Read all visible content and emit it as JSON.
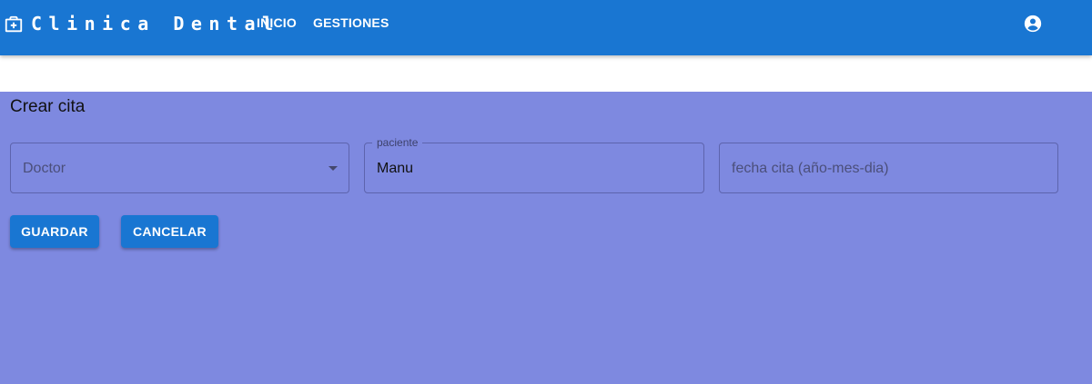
{
  "header": {
    "brand_icon": "medical-briefcase-icon",
    "title": "Clinica Dental",
    "nav": {
      "inicio": "INICIO",
      "gestiones": "GESTIONES"
    },
    "account_icon": "account-circle-icon"
  },
  "form": {
    "title": "Crear cita",
    "doctor": {
      "placeholder": "Doctor",
      "value": ""
    },
    "paciente": {
      "label": "paciente",
      "value": "Manu"
    },
    "fecha": {
      "placeholder": "fecha cita (año-mes-dia)",
      "value": ""
    },
    "buttons": {
      "guardar": "GUARDAR",
      "cancelar": "CANCELAR"
    }
  },
  "colors": {
    "appbar": "#1976d2",
    "content_background": "#7e89e0",
    "button": "#1976d2"
  }
}
